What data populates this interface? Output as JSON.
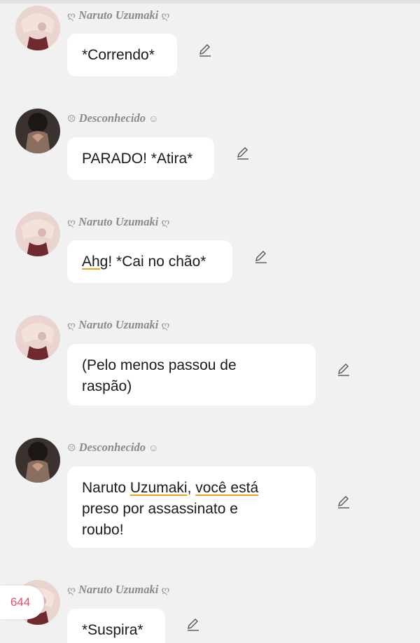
{
  "chat": {
    "messages": [
      {
        "author": "Naruto Uzumaki",
        "author_deco_left": "ღ",
        "author_deco_right": "ღ",
        "text": "*Correndo*",
        "avatar": "naruto-avatar"
      },
      {
        "author": "Desconhecido",
        "author_deco_left": "☹",
        "author_deco_right": "☺",
        "text": "PARADO! *Atira*",
        "avatar": "desconhecido-avatar"
      },
      {
        "author": "Naruto Uzumaki",
        "author_deco_left": "ღ",
        "author_deco_right": "ღ",
        "text_part1": "Ahg",
        "text_part2": "! *Cai no chão*",
        "avatar": "naruto-avatar"
      },
      {
        "author": "Naruto Uzumaki",
        "author_deco_left": "ღ",
        "author_deco_right": "ღ",
        "line1": "(Pelo menos passou de",
        "line2": "raspão)",
        "avatar": "naruto-avatar"
      },
      {
        "author": "Desconhecido",
        "author_deco_left": "☹",
        "author_deco_right": "☺",
        "line1_a": "Naruto ",
        "line1_b": "Uzumaki",
        "line1_c": ", ",
        "line1_d": "você está",
        "line2": "preso por assassinato e",
        "line3": "roubo!",
        "avatar": "desconhecido-avatar"
      },
      {
        "author": "Naruto Uzumaki",
        "author_deco_left": "ღ",
        "author_deco_right": "ღ",
        "text": "*Suspira*",
        "avatar": "naruto-avatar"
      }
    ]
  },
  "counter": {
    "value": "644"
  },
  "icons": {
    "edit": "pencil-icon"
  },
  "colors": {
    "accent": "#e0506a",
    "underline": "#f0a020",
    "background": "#f1f1f1"
  }
}
